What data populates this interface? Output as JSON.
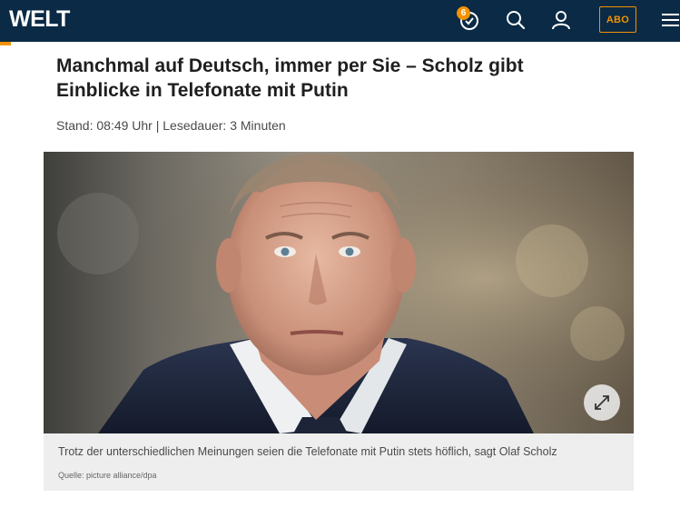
{
  "header": {
    "logo_text": "WELT",
    "history_badge": "6",
    "abo_label": "ABO",
    "bg_color": "#0a2a45",
    "accent_color": "#f39200"
  },
  "icons": {
    "history": "clock-history-icon",
    "search": "search-icon",
    "account": "user-icon",
    "menu": "hamburger-menu-icon",
    "expand": "expand-arrows-icon"
  },
  "article": {
    "headline": "Manchmal auf Deutsch, immer per Sie – Scholz gibt Einblicke in Telefonate mit Putin",
    "meta": "Stand: 08:49 Uhr | Lesedauer: 3 Minuten",
    "image": {
      "caption": "Trotz der unterschiedlichen Meinungen seien die Telefonate mit Putin stets höflich, sagt Olaf Scholz",
      "credit": "Quelle: picture alliance/dpa"
    }
  }
}
